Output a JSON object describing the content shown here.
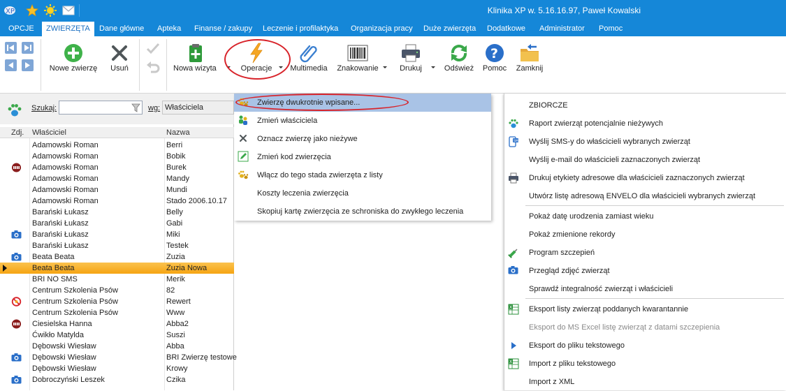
{
  "window": {
    "title": "Klinika XP w. 5.16.16.97, Paweł Kowalski"
  },
  "quick_access": [
    "app-logo-icon",
    "star-icon",
    "sun-icon",
    "mail-icon"
  ],
  "menu": [
    {
      "label": "OPCJE"
    },
    {
      "label": "ZWIERZĘTA"
    },
    {
      "label": "Dane główne"
    },
    {
      "label": "Apteka"
    },
    {
      "label": "Finanse / zakupy"
    },
    {
      "label": "Leczenie i profilaktyka"
    },
    {
      "label": "Organizacja pracy"
    },
    {
      "label": "Duże zwierzęta"
    },
    {
      "label": "Dodatkowe"
    },
    {
      "label": "Administrator"
    },
    {
      "label": "Pomoc"
    }
  ],
  "active_menu": "ZWIERZĘTA",
  "ribbon": {
    "new_animal": "Nowe zwierzę",
    "delete": "Usuń",
    "new_visit": "Nowa wizyta",
    "operations": "Operacje",
    "multimedia": "Multimedia",
    "tagging": "Znakowanie",
    "print": "Drukuj",
    "refresh": "Odśwież",
    "help": "Pomoc",
    "close": "Zamknij"
  },
  "search": {
    "label": "Szukaj:",
    "value": "",
    "by_label": "wg:",
    "by_value": "Właściciela"
  },
  "grid": {
    "columns": [
      "Zdj.",
      "Właściciel",
      "Nazwa"
    ],
    "rows": [
      {
        "owner": "Adamowski Roman",
        "name": "Berri",
        "icon": ""
      },
      {
        "owner": "Adamowski Roman",
        "name": "Bobik",
        "icon": ""
      },
      {
        "owner": "Adamowski Roman",
        "name": "Burek",
        "icon": "aggressive-icon"
      },
      {
        "owner": "Adamowski Roman",
        "name": "Mandy",
        "icon": ""
      },
      {
        "owner": "Adamowski Roman",
        "name": "Mundi",
        "icon": ""
      },
      {
        "owner": "Adamowski Roman",
        "name": "Stado 2006.10.17",
        "icon": ""
      },
      {
        "owner": "Barański Łukasz",
        "name": "Belly",
        "icon": ""
      },
      {
        "owner": "Barański Łukasz",
        "name": "Gabi",
        "icon": ""
      },
      {
        "owner": "Barański Łukasz",
        "name": "Miki",
        "icon": "camera-icon"
      },
      {
        "owner": "Barański Łukasz",
        "name": "Testek",
        "icon": ""
      },
      {
        "owner": "Beata Beata",
        "name": "Zuzia",
        "icon": "camera-icon"
      },
      {
        "owner": "Beata Beata",
        "name": "Zuzia Nowa",
        "icon": ""
      },
      {
        "owner": "BRI NO SMS",
        "name": "Merik",
        "icon": ""
      },
      {
        "owner": "Centrum Szkolenia Psów",
        "name": "82",
        "icon": ""
      },
      {
        "owner": "Centrum Szkolenia Psów",
        "name": "Rewert",
        "icon": "forbidden-icon"
      },
      {
        "owner": "Centrum Szkolenia Psów",
        "name": "Www",
        "icon": ""
      },
      {
        "owner": "Ciesielska Hanna",
        "name": "Abba2",
        "icon": "aggressive-icon"
      },
      {
        "owner": "Ćwikło Matylda",
        "name": "Suszi",
        "icon": ""
      },
      {
        "owner": "Dębowski Wiesław",
        "name": "Abba",
        "icon": ""
      },
      {
        "owner": "Dębowski Wiesław",
        "name": "BRI Zwierzę testowe",
        "icon": "camera-icon"
      },
      {
        "owner": "Dębowski Wiesław",
        "name": "Krowy",
        "icon": ""
      },
      {
        "owner": "Dobroczyński Leszek",
        "name": "Czika",
        "icon": "camera-icon"
      }
    ],
    "selected_row": 11
  },
  "operations_menu": [
    {
      "label": "Zwierzę dwukrotnie wpisane...",
      "icon": "paw-pair-icon"
    },
    {
      "label": "Zmień właściciela",
      "icon": "owners-icon"
    },
    {
      "label": "Oznacz zwierzę jako nieżywe",
      "icon": "x-mark-icon"
    },
    {
      "label": "Zmień kod zwierzęcia",
      "icon": "edit-icon"
    },
    {
      "label": "Włącz do tego stada zwierzęta z listy",
      "icon": "paw-pair-icon"
    },
    {
      "label": "Koszty leczenia zwierzęcia",
      "icon": ""
    },
    {
      "label": "Skopiuj kartę zwierzęcia ze schroniska do zwykłego leczenia",
      "icon": ""
    }
  ],
  "side_menu": [
    {
      "label": "ZBIORCZE",
      "icon": "",
      "disabled": false
    },
    {
      "label": "Raport zwierząt potencjalnie nieżywych",
      "icon": "paw-icon",
      "disabled": false
    },
    {
      "label": "Wyślij SMS-y do właścicieli wybranych zwierząt",
      "icon": "sms-icon",
      "disabled": false
    },
    {
      "label": "Wyślij e-mail do właścicieli zaznaczonych zwierząt",
      "icon": "",
      "disabled": false
    },
    {
      "label": "Drukuj etykiety adresowe dla właścicieli zaznaczonych zwierząt",
      "icon": "printer-icon",
      "disabled": false
    },
    {
      "label": "Utwórz listę adresową ENVELO dla właścicieli wybranych zwierząt",
      "icon": "",
      "disabled": false
    },
    {
      "label": "Pokaż datę urodzenia zamiast wieku",
      "icon": "",
      "disabled": false
    },
    {
      "label": "Pokaż zmienione rekordy",
      "icon": "",
      "disabled": false
    },
    {
      "label": "Program szczepień",
      "icon": "syringe-icon",
      "disabled": false
    },
    {
      "label": "Przegląd zdjęć zwierząt",
      "icon": "camera-icon",
      "disabled": false
    },
    {
      "label": "Sprawdź integralność zwierząt i właścicieli",
      "icon": "",
      "disabled": false
    },
    {
      "label": "Eksport listy zwierząt poddanych kwarantannie",
      "icon": "excel-icon",
      "disabled": false
    },
    {
      "label": "Eksport do MS Excel listę zwierząt z datami szczepienia",
      "icon": "",
      "disabled": true
    },
    {
      "label": "Eksport do pliku tekstowego",
      "icon": "play-icon",
      "disabled": false
    },
    {
      "label": "Import z pliku tekstowego",
      "icon": "excel-icon",
      "disabled": false
    },
    {
      "label": "Import z XML",
      "icon": "",
      "disabled": false
    }
  ]
}
